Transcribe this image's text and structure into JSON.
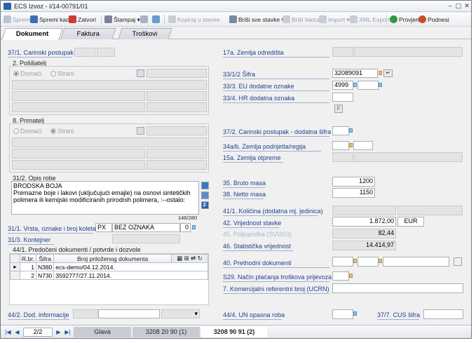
{
  "window": {
    "title": "ECS Izvoz - I/14-00791/01"
  },
  "toolbar": {
    "spremi": "Spremi",
    "spremi_kao": "Spremi kao",
    "zatvori": "Zatvori",
    "stampaj": "Štampaj",
    "kopiraj": "Kopiraj u stavke",
    "brisi_sve": "Briši sve stavke",
    "brisi_fakturu": "Briši fakturu",
    "import": "Import",
    "xml_export": "XML Export",
    "provjeri": "Provjeri",
    "podnesi": "Podnesi"
  },
  "tabs": [
    "Dokument",
    "Faktura",
    "Troškovi"
  ],
  "left": {
    "carinski_postupak_lbl": "37/1. Carinski postupak",
    "posiljatelj_lbl": "2. Pošiljatelj",
    "domaci": "Domaći",
    "strani": "Strani",
    "primatelj_lbl": "8. Primatelj",
    "opis_lbl": "31/2. Opis robe",
    "opis_text": "BRODSKA BOJA\nPremazne boje i lakovi (uključujući emajle) na osnovi sintetičkih polimera ili kemijski modificiranih prirodnih polimera, :--ostalo:",
    "opis_count": "146/280",
    "koleta_lbl": "31/1. Vrsta, oznake i broj koleta",
    "koleta_vrsta": "PX",
    "koleta_oznake": "BEZ OZNAKA",
    "koleta_broj": "0",
    "kontejner_lbl": "31/3. Kontejner",
    "predoceni_lbl": "44/1. Predočeni dokumenti / potvrde i dozvole",
    "grid_headers": [
      "R.br.",
      "Šifra",
      "Broj priloženog dokumenta"
    ],
    "grid_rows": [
      {
        "rbr": "1",
        "sifra": "N380",
        "broj": "ecs-demo/04.12.2014."
      },
      {
        "rbr": "2",
        "sifra": "N730",
        "broj": "3592777/27.11.2014."
      }
    ],
    "dod_info_lbl": "44/2. Dod. informacije"
  },
  "right": {
    "zemlja_odredista_lbl": "17a. Zemlja odredišta",
    "sifra_lbl": "33/1/2 Šifra",
    "sifra_val": "32089091",
    "eu_lbl": "33/3. EU dodatne oznake",
    "eu_val": "4999",
    "hr_lbl": "33/4. HR dodatna oznaka",
    "f_btn": "F",
    "dodatna_sifra_lbl": "37/2. Carinski postupak - dodatna šifra",
    "zemlja_podrijetla_lbl": "34a/b. Zemlja podrijetla/regija",
    "zemlja_otpreme_lbl": "15a. Zemlja otpreme",
    "bruto_lbl": "35. Bruto masa",
    "bruto_val": "1200",
    "neto_lbl": "38. Netto masa",
    "neto_val": "1150",
    "kolicina_lbl": "41/1. Količina (dodatna mj. jedinica)",
    "vrijednost_lbl": "42. Vrijednost stavke",
    "vrijednost_val": "1.872,00",
    "valuta": "EUR",
    "poljoprivreda_lbl": "45. Poljopridba (SVI303)",
    "poljoprivreda_val": "82,44",
    "statisticka_lbl": "46. Statistička vrijednost",
    "statisticka_val": "14.414,97",
    "prethodni_lbl": "40. Prethodni dokumenti",
    "nacin_placanja_lbl": "S29. Način plaćanja troškova prijevoza",
    "ucrn_lbl": "7. Komercijalni referentni broj (UCRN)",
    "un_lbl": "44/4. UN opasna roba",
    "cus_lbl": "37/7. CUS šifra"
  },
  "status": {
    "page": "2/2",
    "tabs": [
      "Glava",
      "3208 20 90  (1)",
      "3208 90 91  (2)"
    ]
  }
}
